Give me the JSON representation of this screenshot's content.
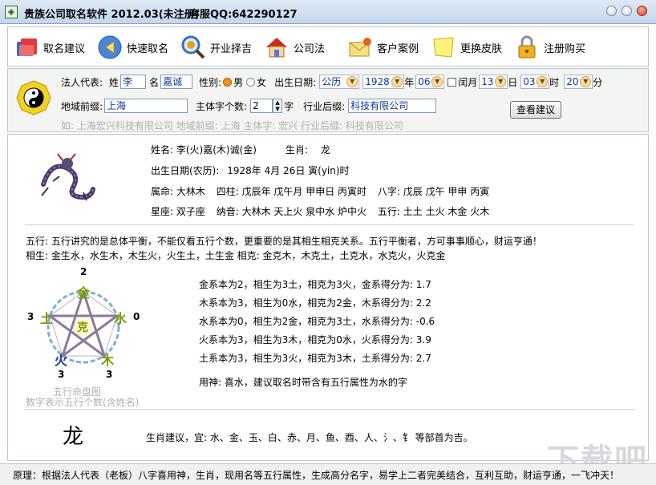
{
  "title": {
    "app": "贵族公司取名软件 2012.03(未注册)",
    "service": "客服QQ:642290127"
  },
  "toolbar": [
    {
      "label": "取名建议",
      "icon": "folder-icon"
    },
    {
      "label": "快速取名",
      "icon": "arrow-left-icon"
    },
    {
      "label": "开业择吉",
      "icon": "magnifier-icon"
    },
    {
      "label": "公司法",
      "icon": "house-icon"
    },
    {
      "label": "客户案例",
      "icon": "envelope-icon"
    },
    {
      "label": "更换皮肤",
      "icon": "note-icon"
    },
    {
      "label": "注册购买",
      "icon": "lock-icon"
    }
  ],
  "form": {
    "legal_rep_label": "法人代表:",
    "surname_label": "姓",
    "surname": "李",
    "given_label": "名",
    "given": "嘉诚",
    "gender_label": "性别:",
    "male": "男",
    "female": "女",
    "birth_label": "出生日期:",
    "calendar": "公历",
    "year": "1928",
    "year_unit": "年",
    "month": "06",
    "leap_label": "闰月",
    "day": "13",
    "day_unit": "日",
    "hour": "03",
    "hour_unit": "时",
    "minute": "20",
    "minute_unit": "分",
    "region_label": "地域前缀:",
    "region": "上海",
    "subject_count_label": "主体字个数:",
    "subject_count": "2",
    "subject_unit": "字",
    "industry_label": "行业后缀:",
    "industry": "科技有限公司",
    "advice_button": "查看建议",
    "hint": "如: 上海宏兴科技有限公司   地域前缀: 上海   主体字: 宏兴   行业后缀: 科技有限公司"
  },
  "profile": {
    "name_label": "姓名:",
    "name_value": "李(火)嘉(木)诚(金)",
    "zodiac_label": "生肖:",
    "zodiac_value": "龙",
    "birth_label": "出生日期(农历):",
    "birth_value": "1928年 4月 26日   寅(yin)时",
    "fate_label": "属命:",
    "fate_value": "大林木",
    "pillars_label": "四柱:",
    "pillars_value": "戊辰年 戊午月 甲申日 丙寅时",
    "bazi_label": "八字:",
    "bazi_value": "戊辰 戊午 甲申 丙寅",
    "star_label": "星座:",
    "star_value": "双子座",
    "nayin_label": "纳音:",
    "nayin_value": "大林木 天上火 泉中水 炉中火",
    "wuxing_label": "五行:",
    "wuxing_value": "土土 土火 木金 火木"
  },
  "wuxing": {
    "line1": "五行: 五行讲究的是总体平衡，不能仅看五行个数，更重要的是其相生相克关系。五行平衡者，方可事事顺心，财运亨通！",
    "line2": "相生:  金生水，水生木，木生火，火生土，土生金          相克:  金克木，木克土，土克水，水克火，火克金",
    "chart_title": "五行命盘图",
    "chart_note": "数字表示五行个数(含姓名)",
    "center": "克",
    "elements": [
      {
        "name": "金",
        "count": "2",
        "color": "#7a9a00"
      },
      {
        "name": "水",
        "count": "0",
        "color": "#7a9a00"
      },
      {
        "name": "木",
        "count": "3",
        "color": "#7a9a00"
      },
      {
        "name": "火",
        "count": "3",
        "color": "#1a3a9a"
      },
      {
        "name": "土",
        "count": "3",
        "color": "#7a9a00"
      }
    ],
    "scores": [
      "金系本为2，相生为3土，相克为3火，金系得分为:   1.7",
      "木系本为3，相生为0水，相克为2金，木系得分为:   2.2",
      "水系本为0，相生为2金，相克为3土，水系得分为:   -0.6",
      "火系本为3，相生为3木，相克为0水，火系得分为:   3.9",
      "土系本为3，相生为3火，相克为3木，土系得分为:   2.7"
    ],
    "yongshen": "用神:  喜水，建议取名时带含有五行属性为水的字"
  },
  "zodiac_advice": {
    "big_char": "龙",
    "text": "生肖建议，宜: 水、金、玉、白、赤、月、鱼、酉、人、氵、钅 等部首为吉。"
  },
  "status": "原理：根据法人代表（老板）八字喜用神，生肖，现用名等五行属性，生成高分名字，易学上二者完美结合，互利互助，财运亨通，一飞冲天！",
  "watermark": "下载吧"
}
